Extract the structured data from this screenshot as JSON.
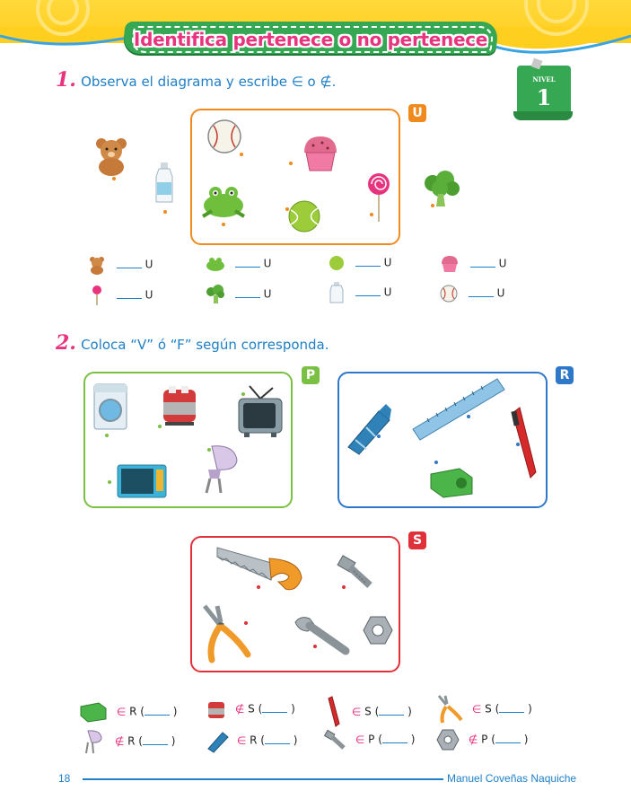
{
  "header": {
    "title": "Identifica pertenece o no pertenece",
    "level_label": "NIVEL",
    "level_number": "1"
  },
  "colors": {
    "header_yellow": "#ffd83a",
    "banner_green": "#36a853",
    "title_pink": "#e8337f",
    "text_blue": "#1f7fc7",
    "set_u": "#f08a1c",
    "set_p": "#7ac143",
    "set_r": "#2f77c9",
    "set_s": "#e0313a"
  },
  "exercise1": {
    "number": "1.",
    "instruction": "Observa el diagrama y escribe ∈ o ∉.",
    "set_label": "U",
    "items_outside": [
      "teddy-bear-icon",
      "milk-bottle-icon",
      "broccoli-icon"
    ],
    "items_inside": [
      "baseball-icon",
      "cupcake-icon",
      "frog-icon",
      "tennis-ball-icon",
      "lollipop-icon"
    ],
    "answers": [
      {
        "icon": "teddy-bear-icon",
        "set": "U"
      },
      {
        "icon": "frog-icon",
        "set": "U"
      },
      {
        "icon": "tennis-ball-icon",
        "set": "U"
      },
      {
        "icon": "cupcake-icon",
        "set": "U"
      },
      {
        "icon": "lollipop-icon",
        "set": "U"
      },
      {
        "icon": "broccoli-icon",
        "set": "U"
      },
      {
        "icon": "milk-bottle-icon",
        "set": "U"
      },
      {
        "icon": "baseball-icon",
        "set": "U"
      }
    ]
  },
  "exercise2": {
    "number": "2.",
    "instruction": "Coloca “V” ó “F” según corresponda.",
    "sets": {
      "P": {
        "label": "P",
        "items": [
          "washing-machine-icon",
          "toaster-icon",
          "tv-icon",
          "microwave-icon",
          "mixer-icon"
        ]
      },
      "R": {
        "label": "R",
        "items": [
          "crayon-icon",
          "ruler-icon",
          "pen-icon",
          "sharpener-icon"
        ]
      },
      "S": {
        "label": "S",
        "items": [
          "saw-icon",
          "bolt-icon",
          "pliers-icon",
          "wrench-icon",
          "nut-icon"
        ]
      }
    },
    "statements": [
      {
        "icon": "sharpener-icon",
        "relation": "∈",
        "set": "R",
        "open": "(",
        "close": ")"
      },
      {
        "icon": "toaster-icon",
        "relation": "∉",
        "set": "S",
        "open": "(",
        "close": ")"
      },
      {
        "icon": "pen-icon",
        "relation": "∈",
        "set": "S",
        "open": "(",
        "close": ")"
      },
      {
        "icon": "pliers-icon",
        "relation": "∈",
        "set": "S",
        "open": "(",
        "close": ")"
      },
      {
        "icon": "mixer-icon",
        "relation": "∉",
        "set": "R",
        "open": "(",
        "close": ")"
      },
      {
        "icon": "crayon-icon",
        "relation": "∈",
        "set": "R",
        "open": "(",
        "close": ")"
      },
      {
        "icon": "bolt-icon",
        "relation": "∈",
        "set": "P",
        "open": "(",
        "close": ")"
      },
      {
        "icon": "nut-icon",
        "relation": "∉",
        "set": "P",
        "open": "(",
        "close": ")"
      }
    ]
  },
  "footer": {
    "page_number": "18",
    "author": "Manuel Coveñas Naquiche"
  }
}
